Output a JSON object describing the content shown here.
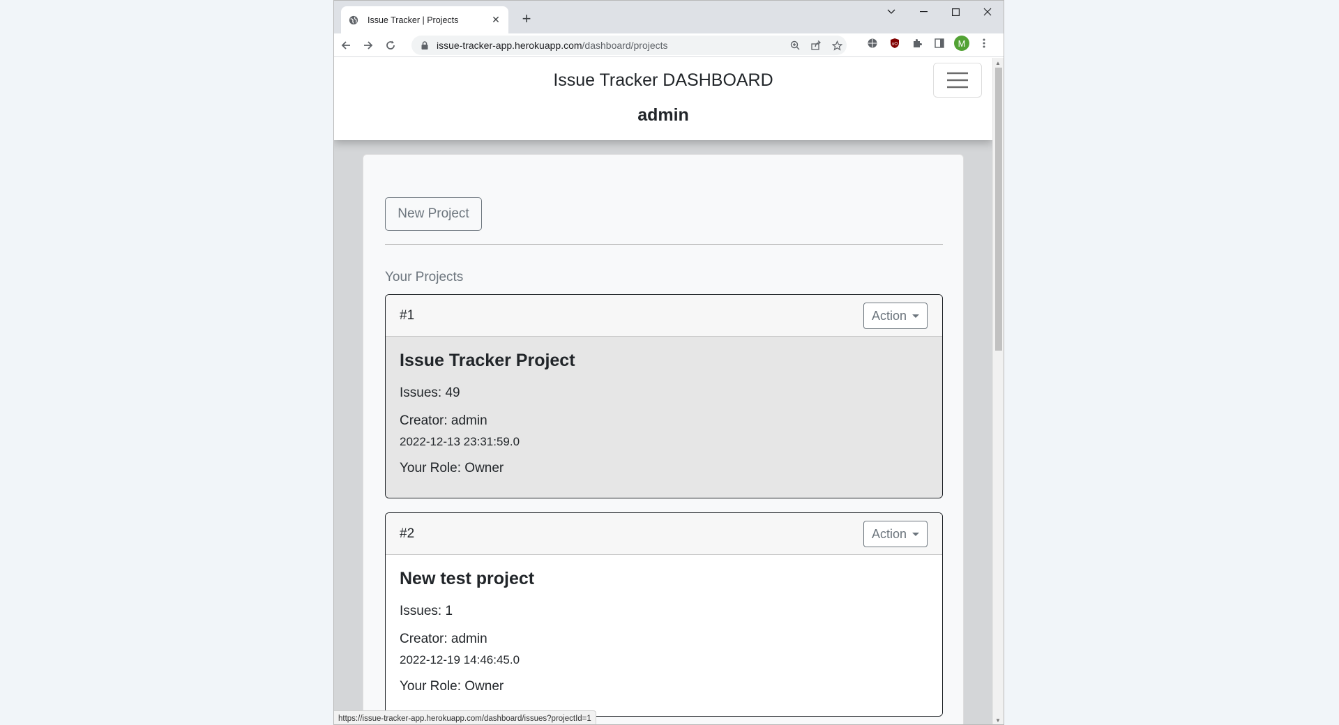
{
  "browser": {
    "tab_title": "Issue Tracker | Projects",
    "tab_close": "✕",
    "new_tab": "+",
    "url_host": "issue-tracker-app.herokuapp.com",
    "url_path": "/dashboard/projects",
    "profile_initial": "M",
    "status_url": "https://issue-tracker-app.herokuapp.com/dashboard/issues?projectId=1"
  },
  "header": {
    "title": "Issue Tracker DASHBOARD",
    "user": "admin"
  },
  "main": {
    "new_project_label": "New Project",
    "section_label": "Your Projects",
    "action_label": "Action",
    "projects": [
      {
        "number": "#1",
        "name": "Issue Tracker Project",
        "issues": "Issues: 49",
        "creator": "Creator: admin",
        "date": "2022-12-13 23:31:59.0",
        "role": "Your Role: Owner"
      },
      {
        "number": "#2",
        "name": "New test project",
        "issues": "Issues: 1",
        "creator": "Creator: admin",
        "date": "2022-12-19 14:46:45.0",
        "role": "Your Role: Owner"
      }
    ]
  }
}
